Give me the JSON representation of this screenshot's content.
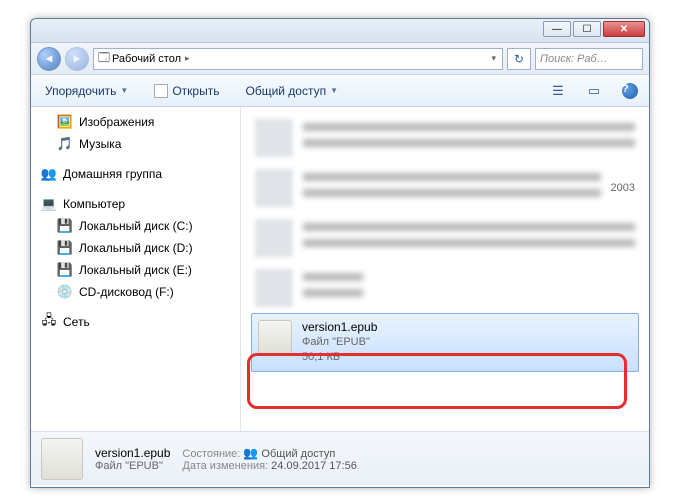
{
  "titlebar": {
    "minimize": "—",
    "maximize": "☐",
    "close": "✕"
  },
  "nav": {
    "back": "◄",
    "fwd": "►",
    "location_icon": "🗔",
    "location": "Рабочий стол",
    "crumb_arrow": "▸",
    "dropdown": "▾",
    "refresh": "↻",
    "search_placeholder": "Поиск: Раб…"
  },
  "toolbar": {
    "organize": "Упорядочить",
    "open": "Открыть",
    "share": "Общий доступ",
    "drop": "▼",
    "view_icon": "☰",
    "preview_icon": "▭",
    "help_icon": "?"
  },
  "sidebar": {
    "items": [
      {
        "icon": "🖼️",
        "label": "Изображения"
      },
      {
        "icon": "🎵",
        "label": "Музыка"
      }
    ],
    "homegroup": {
      "icon": "👥",
      "label": "Домашняя группа"
    },
    "computer": {
      "icon": "💻",
      "label": "Компьютер"
    },
    "drives": [
      {
        "icon": "💾",
        "label": "Локальный диск (C:)"
      },
      {
        "icon": "💾",
        "label": "Локальный диск (D:)"
      },
      {
        "icon": "💾",
        "label": "Локальный диск (E:)"
      },
      {
        "icon": "💿",
        "label": "CD-дисковод (F:)"
      }
    ],
    "network": {
      "icon": "🖧",
      "label": "Сеть"
    }
  },
  "selected_file": {
    "name": "version1.epub",
    "type": "Файл \"EPUB\"",
    "size": "50,1 КБ"
  },
  "blurred_year": "2003",
  "details": {
    "name": "version1.epub",
    "type": "Файл \"EPUB\"",
    "state_label": "Состояние:",
    "state_icon": "👥",
    "state_value": "Общий доступ",
    "modified_label": "Дата изменения:",
    "modified_value": "24.09.2017 17:56"
  }
}
